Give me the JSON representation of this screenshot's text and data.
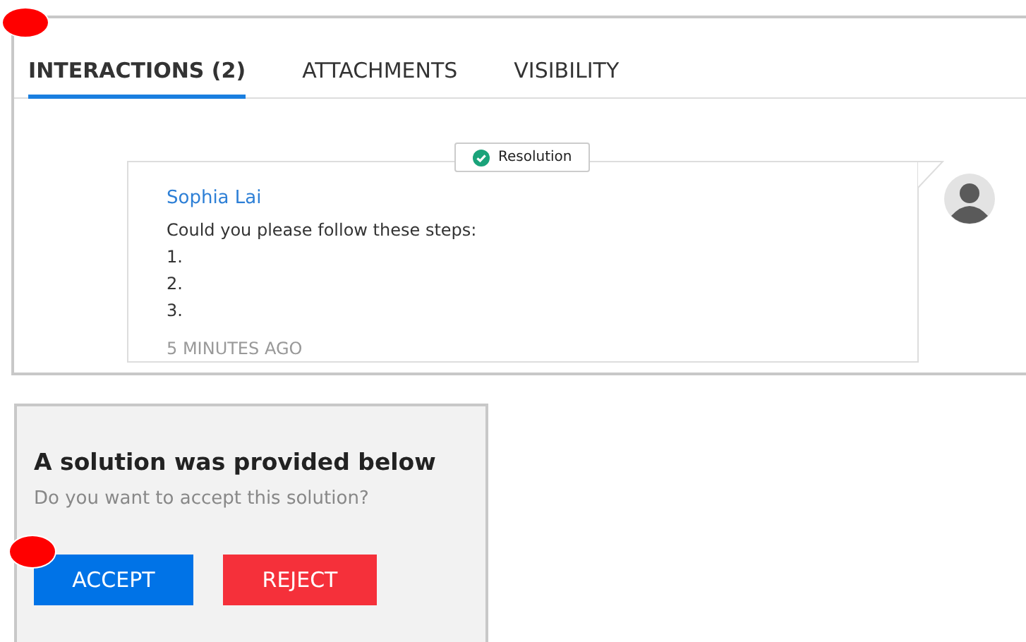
{
  "tabs": [
    {
      "label": "INTERACTIONS (2)",
      "selected": true
    },
    {
      "label": "ATTACHMENTS",
      "selected": false
    },
    {
      "label": "VISIBILITY",
      "selected": false
    }
  ],
  "interaction": {
    "badge": "Resolution",
    "author": "Sophia Lai",
    "lines": [
      "Could you please follow these steps:",
      "1.",
      "2.",
      "3."
    ],
    "time": "5 MINUTES AGO"
  },
  "solution_prompt": {
    "title": "A solution was provided below",
    "question": "Do you want to accept this solution?",
    "buttons": [
      {
        "label": "ACCEPT",
        "kind": "accept"
      },
      {
        "label": "REJECT",
        "kind": "reject"
      }
    ]
  },
  "annotation_markers": [
    {
      "color": "#ff0000"
    },
    {
      "color": "#ff0000"
    }
  ]
}
